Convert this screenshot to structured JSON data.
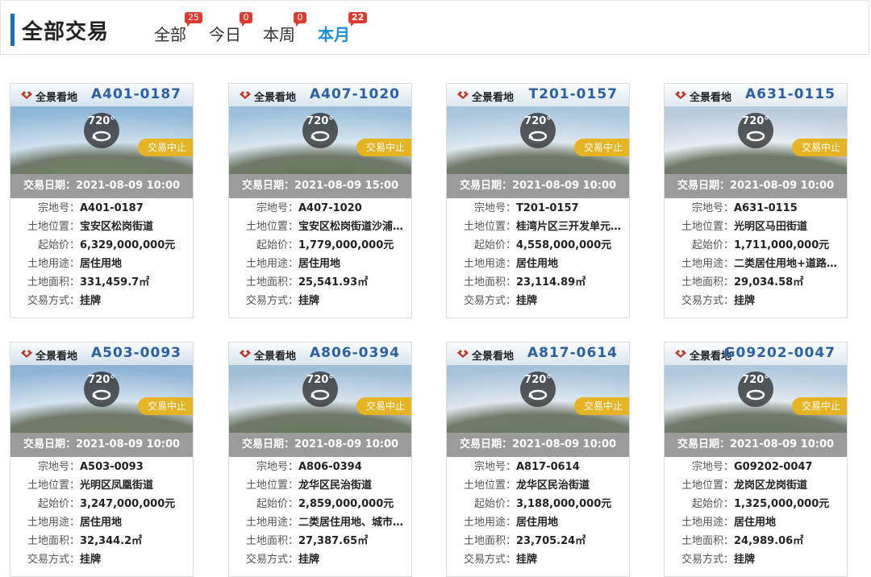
{
  "header": {
    "title": "全部交易",
    "tabs": [
      {
        "label": "全部",
        "count": "25"
      },
      {
        "label": "今日",
        "count": "0"
      },
      {
        "label": "本周",
        "count": "0"
      },
      {
        "label": "本月",
        "count": "22"
      }
    ],
    "active_tab": "本月"
  },
  "labels": {
    "logo_text": "全景看地",
    "vr_degree": "720°",
    "status": "交易中止",
    "date_prefix": "交易日期：",
    "parcel_no": "宗地号：",
    "location": "土地位置：",
    "start_price": "起始价：",
    "land_use": "土地用途：",
    "area": "土地面积：",
    "trade_method": "交易方式："
  },
  "colors": {
    "accent": "#1a8fe0",
    "badge": "#e03a2f",
    "status": "#e6b322",
    "date_bar": "#9b9b9b",
    "code": "#2d5fa6"
  },
  "cards": [
    {
      "code": "A401-0187",
      "date": "2021-08-09 10:00",
      "parcel_no": "A401-0187",
      "location": "宝安区松岗街道",
      "start_price": "6,329,000,000元",
      "land_use": "居住用地",
      "area": "331,459.7㎡",
      "trade_method": "挂牌"
    },
    {
      "code": "A407-1020",
      "date": "2021-08-09 15:00",
      "parcel_no": "A407-1020",
      "location": "宝安区松岗街道沙浦…",
      "start_price": "1,779,000,000元",
      "land_use": "居住用地",
      "area": "25,541.93㎡",
      "trade_method": "挂牌"
    },
    {
      "code": "T201-0157",
      "date": "2021-08-09 10:00",
      "parcel_no": "T201-0157",
      "location": "桂湾片区三开发单元…",
      "start_price": "4,558,000,000元",
      "land_use": "居住用地",
      "area": "23,114.89㎡",
      "trade_method": "挂牌"
    },
    {
      "code": "A631-0115",
      "date": "2021-08-09 10:00",
      "parcel_no": "A631-0115",
      "location": "光明区马田街道",
      "start_price": "1,711,000,000元",
      "land_use": "二类居住用地+道路…",
      "area": "29,034.58㎡",
      "trade_method": "挂牌"
    },
    {
      "code": "A503-0093",
      "date": "2021-08-09 10:00",
      "parcel_no": "A503-0093",
      "location": "光明区凤凰街道",
      "start_price": "3,247,000,000元",
      "land_use": "居住用地",
      "area": "32,344.2㎡",
      "trade_method": "挂牌"
    },
    {
      "code": "A806-0394",
      "date": "2021-08-09 10:00",
      "parcel_no": "A806-0394",
      "location": "龙华区民治街道",
      "start_price": "2,859,000,000元",
      "land_use": "二类居住用地、城市…",
      "area": "27,387.65㎡",
      "trade_method": "挂牌"
    },
    {
      "code": "A817-0614",
      "date": "2021-08-09 10:00",
      "parcel_no": "A817-0614",
      "location": "龙华区民治街道",
      "start_price": "3,188,000,000元",
      "land_use": "居住用地",
      "area": "23,705.24㎡",
      "trade_method": "挂牌"
    },
    {
      "code": "G09202-0047",
      "date": "2021-08-09 10:00",
      "parcel_no": "G09202-0047",
      "location": "龙岗区龙岗街道",
      "start_price": "1,325,000,000元",
      "land_use": "居住用地",
      "area": "24,989.06㎡",
      "trade_method": "挂牌"
    }
  ]
}
